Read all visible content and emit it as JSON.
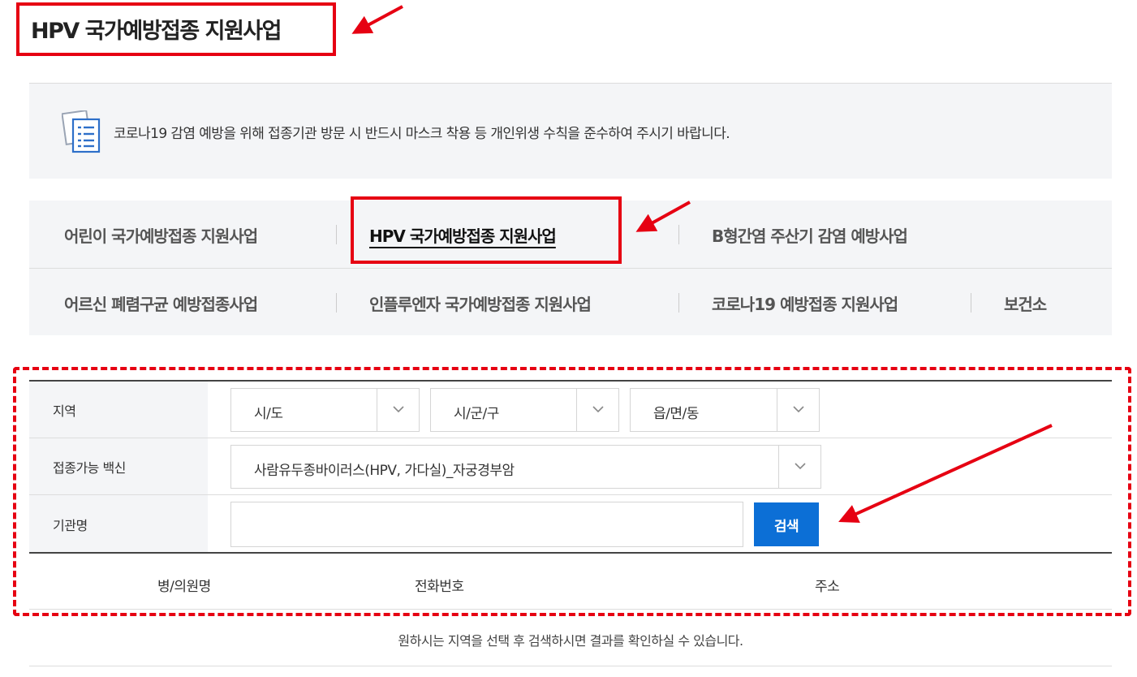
{
  "page": {
    "title": "HPV 국가예방접종 지원사업"
  },
  "notice": {
    "icon": "document-list-icon",
    "text": "코로나19 감염 예방을 위해 접종기관 방문 시 반드시 마스크 착용 등 개인위생 수칙을 준수하여 주시기 바랍니다."
  },
  "tabs": [
    {
      "label": "어린이 국가예방접종 지원사업",
      "active": false
    },
    {
      "label": "HPV 국가예방접종 지원사업",
      "active": true
    },
    {
      "label": "B형간염 주산기 감염 예방사업",
      "active": false
    },
    {
      "label": "어르신 폐렴구균 예방접종사업",
      "active": false
    },
    {
      "label": "인플루엔자 국가예방접종 지원사업",
      "active": false
    },
    {
      "label": "코로나19 예방접종 지원사업",
      "active": false
    },
    {
      "label": "보건소",
      "active": false
    }
  ],
  "search": {
    "region_label": "지역",
    "sido_value": "시/도",
    "sigungu_value": "시/군/구",
    "eupmyeondong_value": "읍/면/동",
    "vaccine_label": "접종가능 백신",
    "vaccine_value": "사람유두종바이러스(HPV, 가다실)_자궁경부암",
    "institution_label": "기관명",
    "institution_value": "",
    "search_button": "검색"
  },
  "results_table": {
    "headers": [
      "병/의원명",
      "전화번호",
      "주소"
    ],
    "empty_message": "원하시는 지역을 선택 후 검색하시면 결과를 확인하실 수 있습니다."
  },
  "colors": {
    "annotation_red": "#e60012",
    "button_blue": "#0c6fd6",
    "panel_gray": "#f4f5f7"
  }
}
